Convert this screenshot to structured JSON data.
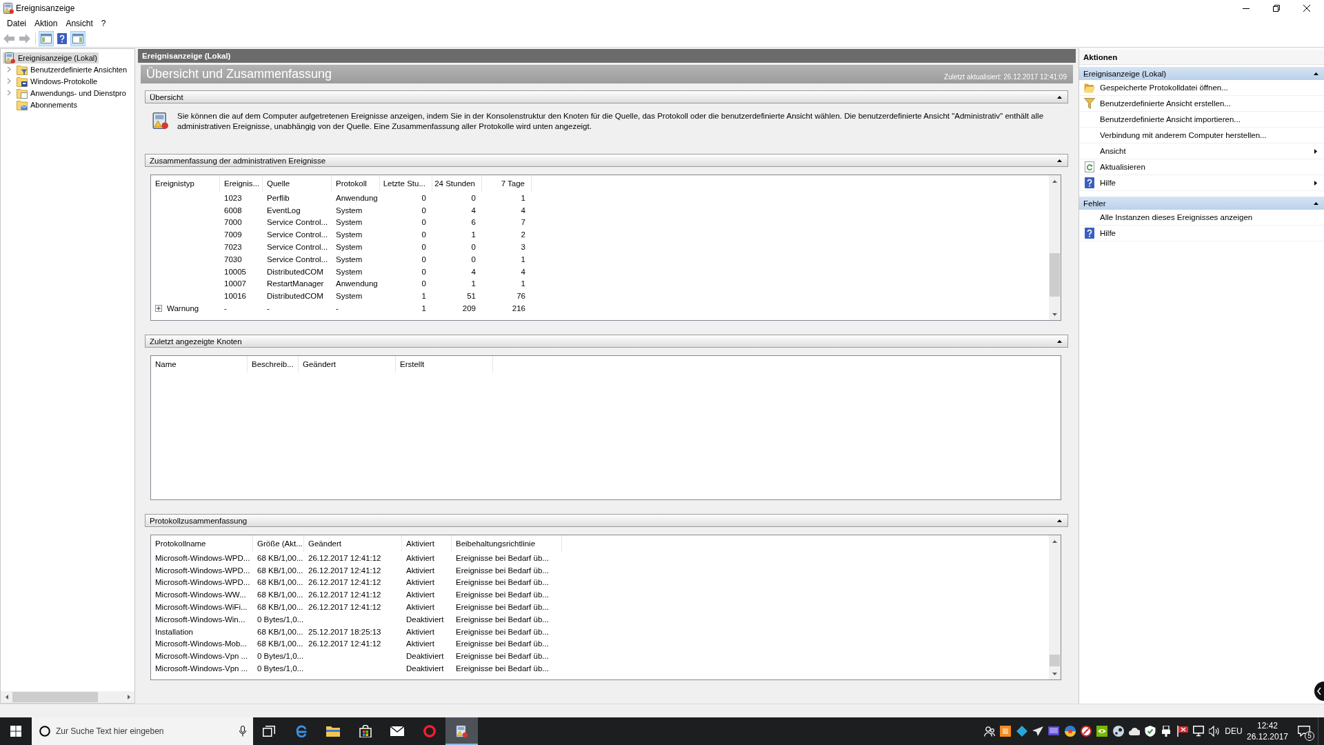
{
  "window": {
    "title": "Ereignisanzeige"
  },
  "menu": [
    {
      "label": "Datei"
    },
    {
      "label": "Aktion"
    },
    {
      "label": "Ansicht"
    },
    {
      "label": "?"
    }
  ],
  "toolbar": [
    {
      "kind": "back",
      "disabled": true,
      "pressed": false
    },
    {
      "kind": "forward",
      "disabled": true,
      "pressed": false
    },
    {
      "kind": "tree",
      "disabled": false,
      "pressed": true
    },
    {
      "kind": "help",
      "disabled": false,
      "pressed": false
    },
    {
      "kind": "actions",
      "disabled": false,
      "pressed": true
    }
  ],
  "tree": {
    "items": [
      {
        "label": "Ereignisanzeige (Lokal)",
        "kind": "viewer",
        "selected": true,
        "children": [
          {
            "label": "Benutzerdefinierte Ansichten",
            "kind": "filter",
            "selected": false,
            "expanded": false
          },
          {
            "label": "Windows-Protokolle",
            "kind": "logs",
            "selected": false,
            "expanded": false
          },
          {
            "label": "Anwendungs- und Dienstpro",
            "kind": "apps",
            "selected": false,
            "expanded": false
          },
          {
            "label": "Abonnements",
            "kind": "subscriptions",
            "selected": false
          }
        ]
      }
    ]
  },
  "main": {
    "header": "Ereignisanzeige (Lokal)",
    "title": "Übersicht und Zusammenfassung",
    "updated": "Zuletzt aktualisiert: 26.12.2017 12:41:09",
    "sections": [
      {
        "kind": "overview",
        "title": "Übersicht",
        "expanded": true,
        "text": "Sie können die auf dem Computer aufgetretenen Ereignisse anzeigen, indem Sie in der Konsolenstruktur den Knoten für die Quelle, das Protokoll oder die benutzerdefinierte Ansicht wählen. Die benutzerdefinierte Ansicht \"Administrativ\" enthält alle administrativen Ereignisse, unabhängig von der Quelle. Eine Zusammenfassung aller Protokolle wird unten angezeigt."
      },
      {
        "kind": "events",
        "title": "Zusammenfassung der administrativen Ereignisse",
        "expanded": true,
        "columns": [
          "Ereignistyp",
          "Ereignis...",
          "Quelle",
          "Protokoll",
          "Letzte Stu...",
          "24 Stunden",
          "7 Tage"
        ],
        "rows": [
          {
            "kind": "event",
            "event_id": "1023",
            "source": "Perflib",
            "log": "Anwendung",
            "last_hour": "0",
            "last_day": "0",
            "last_week": "1"
          },
          {
            "kind": "event",
            "event_id": "6008",
            "source": "EventLog",
            "log": "System",
            "last_hour": "0",
            "last_day": "4",
            "last_week": "4"
          },
          {
            "kind": "event",
            "event_id": "7000",
            "source": "Service Control...",
            "log": "System",
            "last_hour": "0",
            "last_day": "6",
            "last_week": "7"
          },
          {
            "kind": "event",
            "event_id": "7009",
            "source": "Service Control...",
            "log": "System",
            "last_hour": "0",
            "last_day": "1",
            "last_week": "2"
          },
          {
            "kind": "event",
            "event_id": "7023",
            "source": "Service Control...",
            "log": "System",
            "last_hour": "0",
            "last_day": "0",
            "last_week": "3"
          },
          {
            "kind": "event",
            "event_id": "7030",
            "source": "Service Control...",
            "log": "System",
            "last_hour": "0",
            "last_day": "0",
            "last_week": "1"
          },
          {
            "kind": "event",
            "event_id": "10005",
            "source": "DistributedCOM",
            "log": "System",
            "last_hour": "0",
            "last_day": "4",
            "last_week": "4"
          },
          {
            "kind": "event",
            "event_id": "10007",
            "source": "RestartManager",
            "log": "Anwendung",
            "last_hour": "0",
            "last_day": "1",
            "last_week": "1"
          },
          {
            "kind": "event",
            "event_id": "10016",
            "source": "DistributedCOM",
            "log": "System",
            "last_hour": "1",
            "last_day": "51",
            "last_week": "76"
          },
          {
            "kind": "group",
            "label": "Warnung",
            "expanded": false,
            "event_id": "-",
            "source": "-",
            "log": "-",
            "last_hour": "1",
            "last_day": "209",
            "last_week": "216"
          }
        ]
      },
      {
        "kind": "nodes",
        "title": "Zuletzt angezeigte Knoten",
        "expanded": true,
        "columns": [
          "Name",
          "Beschreib...",
          "Geändert",
          "Erstellt"
        ]
      },
      {
        "kind": "logs",
        "title": "Protokollzusammenfassung",
        "expanded": true,
        "columns": [
          "Protokollname",
          "Größe (Akt...",
          "Geändert",
          "Aktiviert",
          "Beibehaltungsrichtlinie"
        ],
        "rows": [
          {
            "name": "Microsoft-Windows-WPD...",
            "size": "68 KB/1,00...",
            "changed": "26.12.2017 12:41:12",
            "status": "Aktiviert",
            "retention": "Ereignisse bei Bedarf üb..."
          },
          {
            "name": "Microsoft-Windows-WPD...",
            "size": "68 KB/1,00...",
            "changed": "26.12.2017 12:41:12",
            "status": "Aktiviert",
            "retention": "Ereignisse bei Bedarf üb..."
          },
          {
            "name": "Microsoft-Windows-WPD...",
            "size": "68 KB/1,00...",
            "changed": "26.12.2017 12:41:12",
            "status": "Aktiviert",
            "retention": "Ereignisse bei Bedarf üb..."
          },
          {
            "name": "Microsoft-Windows-WW...",
            "size": "68 KB/1,00...",
            "changed": "26.12.2017 12:41:12",
            "status": "Aktiviert",
            "retention": "Ereignisse bei Bedarf üb..."
          },
          {
            "name": "Microsoft-Windows-WiFi...",
            "size": "68 KB/1,00...",
            "changed": "26.12.2017 12:41:12",
            "status": "Aktiviert",
            "retention": "Ereignisse bei Bedarf üb..."
          },
          {
            "name": "Microsoft-Windows-Win...",
            "size": "0 Bytes/1,0...",
            "status": "Deaktiviert",
            "retention": "Ereignisse bei Bedarf üb..."
          },
          {
            "name": "Installation",
            "size": "68 KB/1,00...",
            "changed": "25.12.2017 18:25:13",
            "status": "Aktiviert",
            "retention": "Ereignisse bei Bedarf üb..."
          },
          {
            "name": "Microsoft-Windows-Mob...",
            "size": "68 KB/1,00...",
            "changed": "26.12.2017 12:41:12",
            "status": "Aktiviert",
            "retention": "Ereignisse bei Bedarf üb..."
          },
          {
            "name": "Microsoft-Windows-Vpn ...",
            "size": "0 Bytes/1,0...",
            "status": "Deaktiviert",
            "retention": "Ereignisse bei Bedarf üb..."
          },
          {
            "name": "Microsoft-Windows-Vpn ...",
            "size": "0 Bytes/1,0...",
            "status": "Deaktiviert",
            "retention": "Ereignisse bei Bedarf üb..."
          }
        ]
      }
    ]
  },
  "actions": {
    "title": "Aktionen",
    "groups": [
      {
        "title": "Ereignisanzeige (Lokal)",
        "expanded": true,
        "items": [
          {
            "label": "Gespeicherte Protokolldatei öffnen...",
            "kind": "open",
            "submenu": false
          },
          {
            "label": "Benutzerdefinierte Ansicht erstellen...",
            "kind": "filter",
            "submenu": false
          },
          {
            "label": "Benutzerdefinierte Ansicht importieren...",
            "kind": "plain",
            "submenu": false
          },
          {
            "label": "Verbindung mit anderem Computer herstellen...",
            "kind": "plain",
            "submenu": false
          },
          {
            "label": "Ansicht",
            "kind": "plain",
            "submenu": true
          },
          {
            "label": "Aktualisieren",
            "kind": "refresh",
            "submenu": false
          },
          {
            "label": "Hilfe",
            "kind": "help",
            "submenu": true
          }
        ]
      },
      {
        "title": "Fehler",
        "expanded": true,
        "items": [
          {
            "label": "Alle Instanzen dieses Ereignisses anzeigen",
            "kind": "plain",
            "submenu": false
          },
          {
            "label": "Hilfe",
            "kind": "help",
            "submenu": false
          }
        ]
      }
    ]
  },
  "taskbar": {
    "search": {
      "placeholder": "Zur Suche Text hier eingeben"
    },
    "apps": [
      {
        "kind": "taskview",
        "selected": false
      },
      {
        "kind": "edge",
        "selected": false
      },
      {
        "kind": "explorer",
        "selected": false
      },
      {
        "kind": "store",
        "selected": false
      },
      {
        "kind": "mail",
        "selected": false
      },
      {
        "kind": "opera",
        "selected": false
      },
      {
        "kind": "eventviewer",
        "selected": true
      }
    ],
    "tray": [
      {
        "kind": "people"
      },
      {
        "kind": "tile"
      },
      {
        "kind": "diamond"
      },
      {
        "kind": "plane"
      },
      {
        "kind": "screen"
      },
      {
        "kind": "ball"
      },
      {
        "kind": "dial"
      },
      {
        "kind": "chip"
      },
      {
        "kind": "disc"
      },
      {
        "kind": "cloud"
      },
      {
        "kind": "shield"
      },
      {
        "kind": "plug"
      },
      {
        "kind": "flag"
      },
      {
        "kind": "network"
      },
      {
        "kind": "speaker"
      }
    ],
    "language": "DEU",
    "time": "12:42",
    "date": "26.12.2017",
    "notifications": "5"
  }
}
